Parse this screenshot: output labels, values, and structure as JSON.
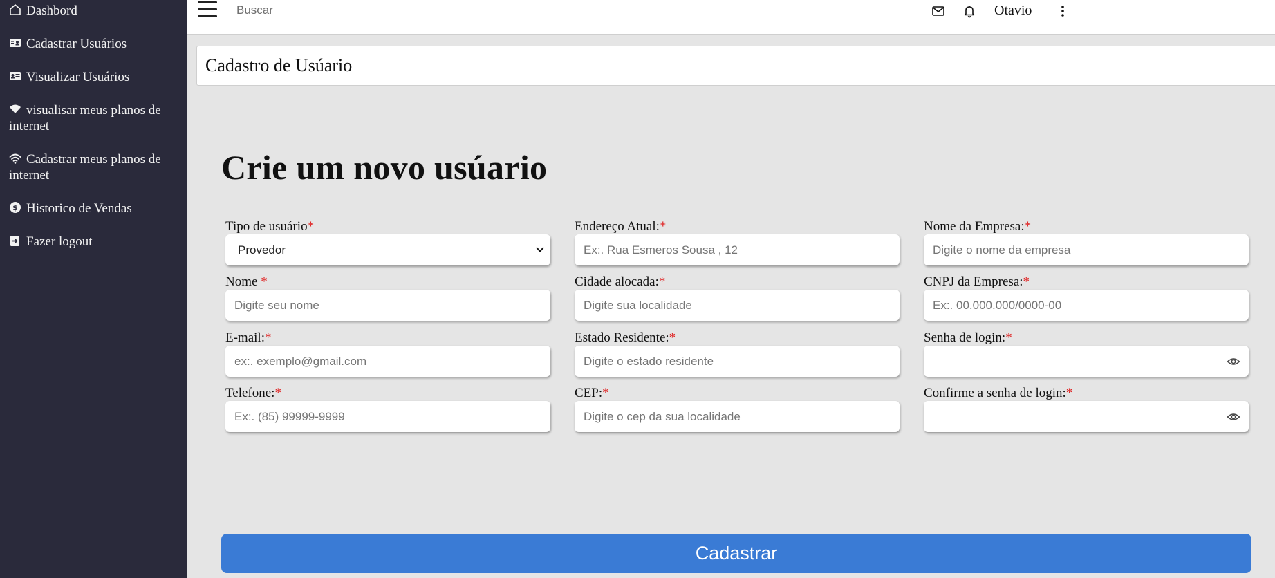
{
  "sidebar": {
    "items": [
      {
        "label": "Dashbord",
        "icon": "home-icon"
      },
      {
        "label": "Cadastrar Usuários",
        "icon": "id-badge-icon"
      },
      {
        "label": "Visualizar Usuários",
        "icon": "id-card-icon"
      },
      {
        "label": "visualisar meus planos de internet",
        "icon": "wifi-filled-icon"
      },
      {
        "label": "Cadastrar meus planos de internet",
        "icon": "wifi-icon"
      },
      {
        "label": "Historico de Vendas",
        "icon": "dollar-circle-icon"
      },
      {
        "label": "Fazer logout",
        "icon": "logout-icon"
      }
    ]
  },
  "topbar": {
    "search_placeholder": "Buscar",
    "username": "Otavio"
  },
  "page": {
    "card_title": "Cadastro de Usúario",
    "heading": "Crie um novo usúario",
    "submit_label": "Cadastrar"
  },
  "form": {
    "user_type": {
      "label": "Tipo de usuário",
      "required": "*",
      "value": "Provedor"
    },
    "name": {
      "label": "Nome ",
      "required": "*",
      "placeholder": "Digite seu nome",
      "value": ""
    },
    "email": {
      "label": "E-mail:",
      "required": "*",
      "placeholder": "ex:. exemplo@gmail.com",
      "value": ""
    },
    "phone": {
      "label": "Telefone:",
      "required": "*",
      "placeholder": "Ex:. (85) 99999-9999",
      "value": ""
    },
    "address": {
      "label": "Endereço Atual:",
      "required": "*",
      "placeholder": "Ex:. Rua Esmeros Sousa , 12",
      "value": ""
    },
    "city": {
      "label": "Cidade alocada:",
      "required": "*",
      "placeholder": "Digite sua localidade",
      "value": ""
    },
    "state": {
      "label": "Estado Residente:",
      "required": "*",
      "placeholder": "Digite o estado residente",
      "value": ""
    },
    "cep": {
      "label": "CEP:",
      "required": "*",
      "placeholder": "Digite o cep da sua localidade",
      "value": ""
    },
    "company_name": {
      "label": "Nome da Empresa:",
      "required": "*",
      "placeholder": "Digite o nome da empresa",
      "value": ""
    },
    "cnpj": {
      "label": "CNPJ da Empresa:",
      "required": "*",
      "placeholder": "Ex:. 00.000.000/0000-00",
      "value": ""
    },
    "password": {
      "label": "Senha de login:",
      "required": "*",
      "value": ""
    },
    "password_confirm": {
      "label": "Confirme a senha de login:",
      "required": "*",
      "value": ""
    }
  },
  "colors": {
    "sidebar_bg": "#2a2a3b",
    "accent": "#3a7bd5",
    "required": "#e02020",
    "page_bg": "#e5e5e5"
  }
}
